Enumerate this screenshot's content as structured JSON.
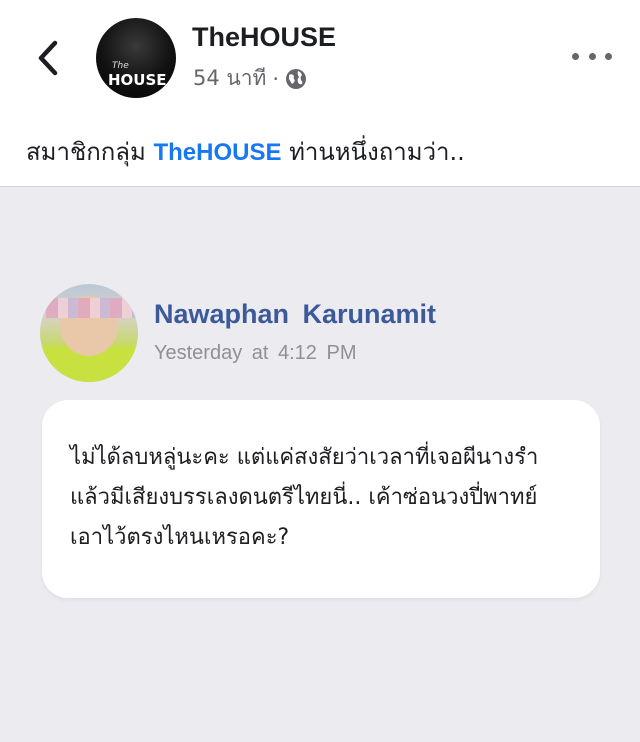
{
  "header": {
    "back_icon": "chevron-left-icon",
    "page_avatar": {
      "logo_small": "The",
      "logo_large": "HOUSE"
    },
    "page_name": "TheHOUSE",
    "time_ago": "54 นาที",
    "separator": "·",
    "privacy_icon": "globe-icon",
    "more_icon": "more-horizontal-icon"
  },
  "caption": {
    "before": "สมาชิกกลุ่ม ",
    "mention": "TheHOUSE",
    "after": " ท่านหนึ่งถามว่า.."
  },
  "embedded_post": {
    "author": "Nawaphan  Karunamit",
    "timestamp": "Yesterday  at  4:12  PM",
    "message_lines": [
      "ไม่ได้ลบหลู่นะคะ แต่แค่สงสัยว่าเวลาที่เจอผีนางรำ",
      "แล้วมีเสียงบรรเลงดนตรีไทยนี่.. เค้าซ่อนวงปี่พาทย์",
      "เอาไว้ตรงไหนเหรอคะ?"
    ]
  },
  "colors": {
    "mention": "#1877f2",
    "author_name": "#3c5a99",
    "meta_gray": "#65676b",
    "image_background": "#ebebf0"
  }
}
